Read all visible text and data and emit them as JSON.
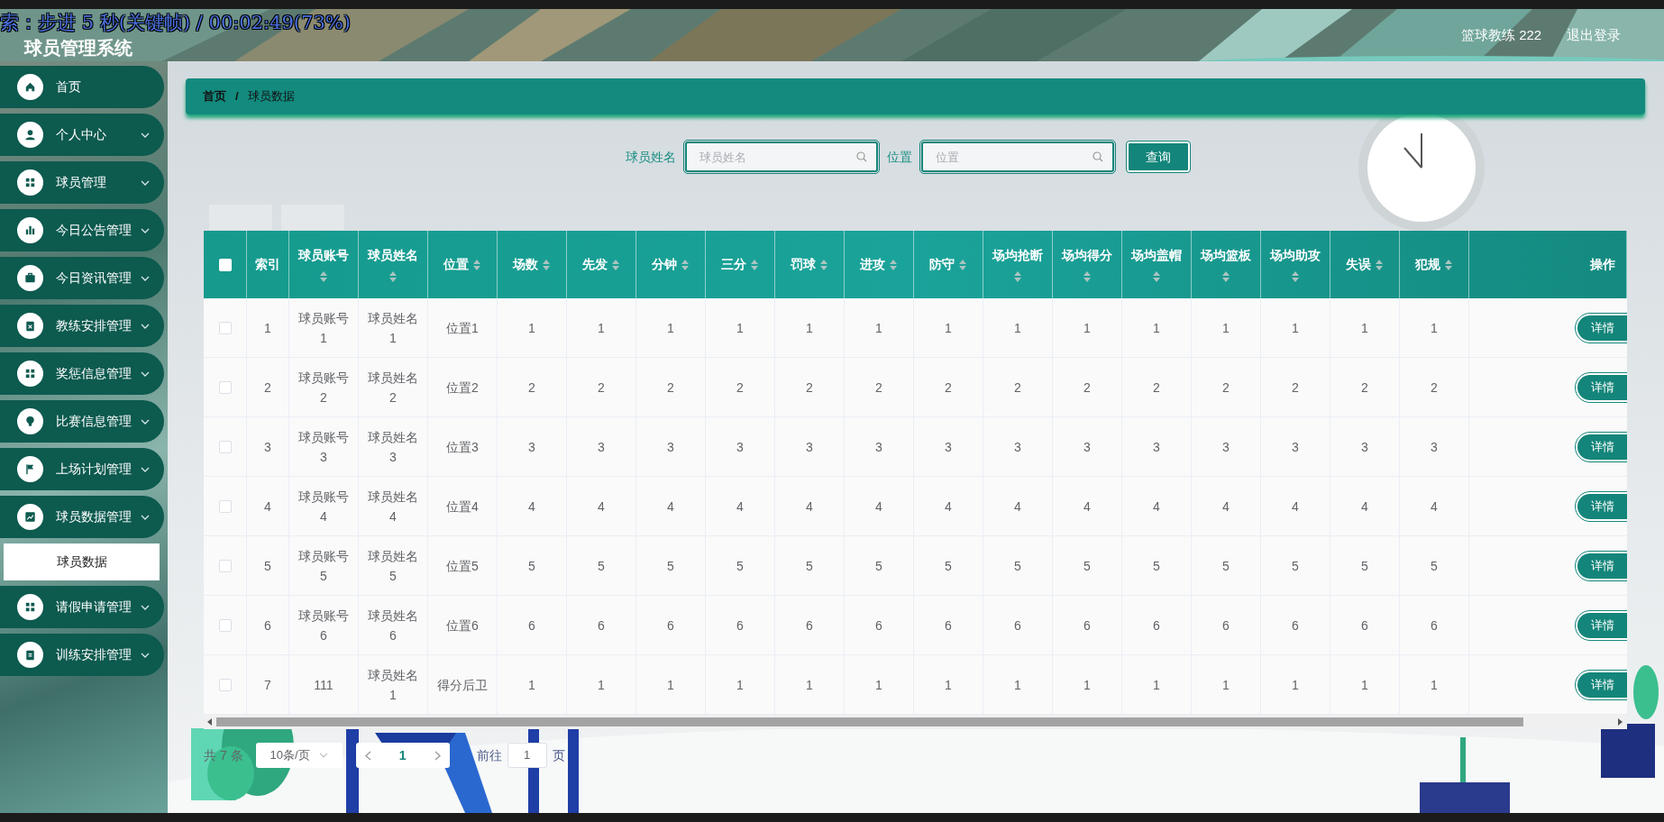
{
  "osd_text": "索：步进 5 秒(关键帧) / 00:02:49(73%)",
  "header": {
    "title": "球员管理系统",
    "user": "篮球教练 222",
    "logout": "退出登录"
  },
  "sidebar": {
    "items": [
      {
        "label": "首页",
        "kind": "link"
      },
      {
        "label": "个人中心",
        "kind": "menu"
      },
      {
        "label": "球员管理",
        "kind": "menu"
      },
      {
        "label": "今日公告管理",
        "kind": "menu"
      },
      {
        "label": "今日资讯管理",
        "kind": "menu"
      },
      {
        "label": "教练安排管理",
        "kind": "menu"
      },
      {
        "label": "奖惩信息管理",
        "kind": "menu"
      },
      {
        "label": "比赛信息管理",
        "kind": "menu"
      },
      {
        "label": "上场计划管理",
        "kind": "menu"
      },
      {
        "label": "球员数据管理",
        "kind": "menu",
        "children": [
          {
            "label": "球员数据",
            "selected": true
          }
        ]
      },
      {
        "label": "请假申请管理",
        "kind": "menu"
      },
      {
        "label": "训练安排管理",
        "kind": "menu"
      }
    ]
  },
  "breadcrumb": [
    "首页",
    "/",
    "球员数据"
  ],
  "search": {
    "fields": [
      {
        "label": "球员姓名",
        "placeholder": "球员姓名"
      },
      {
        "label": "位置",
        "placeholder": "位置"
      }
    ],
    "button": "查询"
  },
  "table": {
    "header_checked": false,
    "columns": [
      {
        "label": "索引"
      },
      {
        "label": "球员账号",
        "sortable": true
      },
      {
        "label": "球员姓名",
        "sortable": true
      },
      {
        "label": "位置",
        "sortable": true
      },
      {
        "label": "场数",
        "sortable": true
      },
      {
        "label": "先发",
        "sortable": true
      },
      {
        "label": "分钟",
        "sortable": true
      },
      {
        "label": "三分",
        "sortable": true
      },
      {
        "label": "罚球",
        "sortable": true
      },
      {
        "label": "进攻",
        "sortable": true
      },
      {
        "label": "防守",
        "sortable": true
      },
      {
        "label": "场均抢断",
        "sortable": true
      },
      {
        "label": "场均得分",
        "sortable": true
      },
      {
        "label": "场均盖帽",
        "sortable": true
      },
      {
        "label": "场均篮板",
        "sortable": true
      },
      {
        "label": "场均助攻",
        "sortable": true
      },
      {
        "label": "失误",
        "sortable": true
      },
      {
        "label": "犯规",
        "sortable": true
      },
      {
        "label": "操作"
      }
    ],
    "rows": [
      {
        "checked": false,
        "cells": [
          "1",
          "球员账号1",
          "球员姓名1",
          "位置1",
          "1",
          "1",
          "1",
          "1",
          "1",
          "1",
          "1",
          "1",
          "1",
          "1",
          "1",
          "1",
          "1",
          "1"
        ],
        "action": "详情"
      },
      {
        "checked": false,
        "cells": [
          "2",
          "球员账号2",
          "球员姓名2",
          "位置2",
          "2",
          "2",
          "2",
          "2",
          "2",
          "2",
          "2",
          "2",
          "2",
          "2",
          "2",
          "2",
          "2",
          "2"
        ],
        "action": "详情"
      },
      {
        "checked": false,
        "cells": [
          "3",
          "球员账号3",
          "球员姓名3",
          "位置3",
          "3",
          "3",
          "3",
          "3",
          "3",
          "3",
          "3",
          "3",
          "3",
          "3",
          "3",
          "3",
          "3",
          "3"
        ],
        "action": "详情"
      },
      {
        "checked": false,
        "cells": [
          "4",
          "球员账号4",
          "球员姓名4",
          "位置4",
          "4",
          "4",
          "4",
          "4",
          "4",
          "4",
          "4",
          "4",
          "4",
          "4",
          "4",
          "4",
          "4",
          "4"
        ],
        "action": "详情"
      },
      {
        "checked": false,
        "cells": [
          "5",
          "球员账号5",
          "球员姓名5",
          "位置5",
          "5",
          "5",
          "5",
          "5",
          "5",
          "5",
          "5",
          "5",
          "5",
          "5",
          "5",
          "5",
          "5",
          "5"
        ],
        "action": "详情"
      },
      {
        "checked": false,
        "cells": [
          "6",
          "球员账号6",
          "球员姓名6",
          "位置6",
          "6",
          "6",
          "6",
          "6",
          "6",
          "6",
          "6",
          "6",
          "6",
          "6",
          "6",
          "6",
          "6",
          "6"
        ],
        "action": "详情"
      },
      {
        "checked": false,
        "cells": [
          "7",
          "111",
          "球员姓名1",
          "得分后卫",
          "1",
          "1",
          "1",
          "1",
          "1",
          "1",
          "1",
          "1",
          "1",
          "1",
          "1",
          "1",
          "1",
          "1"
        ],
        "action": "详情"
      }
    ]
  },
  "pagination": {
    "total": "共 7 条",
    "page_size": "10条/页",
    "pages": [
      {
        "label": "1",
        "selected": true
      }
    ],
    "goto_label": "前往",
    "goto_value": "1",
    "goto_suffix": "页"
  }
}
